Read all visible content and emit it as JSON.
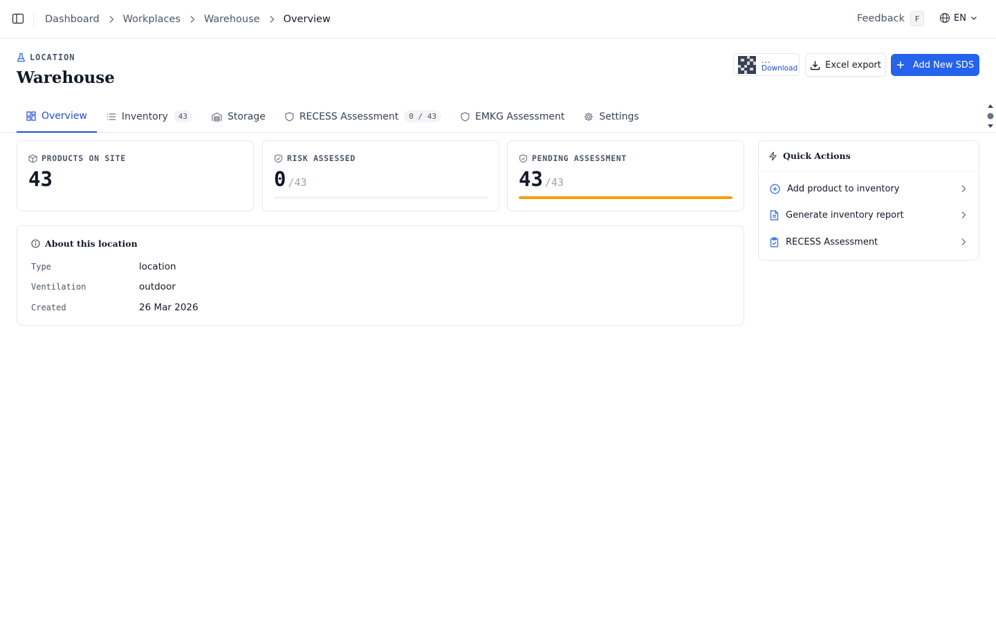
{
  "topbar": {
    "breadcrumbs": [
      "Dashboard",
      "Workplaces",
      "Warehouse",
      "Overview"
    ],
    "feedback_label": "Feedback",
    "feedback_shortcut": "F",
    "language": "EN"
  },
  "header": {
    "kicker": "LOCATION",
    "title": "Warehouse",
    "qr_dots": "...",
    "qr_download": "Download",
    "excel_export_label": "Excel export",
    "add_sds_label": "Add New SDS"
  },
  "tabs": [
    {
      "label": "Overview",
      "icon": "layout-dashboard-icon",
      "active": true
    },
    {
      "label": "Inventory",
      "icon": "list-icon",
      "badge": "43"
    },
    {
      "label": "Storage",
      "icon": "warehouse-icon"
    },
    {
      "label": "RECESS Assessment",
      "icon": "shield-icon",
      "badge": "0 / 43"
    },
    {
      "label": "EMKG Assessment",
      "icon": "shield-icon"
    },
    {
      "label": "Settings",
      "icon": "gear-icon"
    }
  ],
  "stats": {
    "products": {
      "label": "PRODUCTS ON SITE",
      "value": "43"
    },
    "risk": {
      "label": "RISK ASSESSED",
      "value": "0",
      "total": "/43",
      "fraction": 0
    },
    "pending": {
      "label": "PENDING ASSESSMENT",
      "value": "43",
      "total": "/43",
      "fraction": 1
    }
  },
  "about": {
    "title": "About this location",
    "rows": [
      {
        "key": "Type",
        "value": "location"
      },
      {
        "key": "Ventilation",
        "value": "outdoor"
      },
      {
        "key": "Created",
        "value": "26 Mar 2026"
      }
    ]
  },
  "quick_actions": {
    "title": "Quick Actions",
    "items": [
      {
        "label": "Add product to inventory",
        "icon": "plus-circle-icon"
      },
      {
        "label": "Generate inventory report",
        "icon": "file-text-icon"
      },
      {
        "label": "RECESS Assessment",
        "icon": "clipboard-check-icon"
      }
    ]
  },
  "colors": {
    "accent": "#2563eb",
    "pending_bar": "#f59e0b",
    "border": "#e5e7eb"
  }
}
